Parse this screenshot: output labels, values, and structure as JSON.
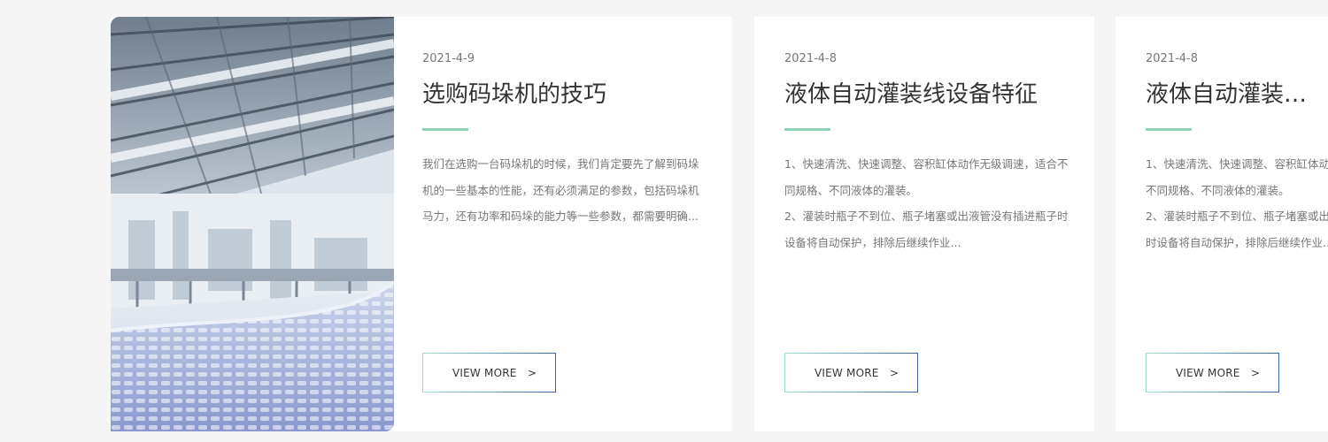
{
  "cards": [
    {
      "date": "2021-4-9",
      "title": "选购码垛机的技巧",
      "description": [
        "我们在选购一台码垛机的时候，我们肯定要先了解到码垛机的一些基本的性能，还有必须满足的参数，包括码垛机马力，还有功率和码垛的能力等一些参数，都需要明确..."
      ],
      "button_label": "VIEW MORE",
      "button_arrow": ">",
      "image_icon": "factory-conveyor-photo"
    },
    {
      "date": "2021-4-8",
      "title": "液体自动灌装线设备特征",
      "description": [
        "1、快速清洗、快速调整、容积缸体动作无级调速，适合不同规格、不同液体的灌装。",
        "2、灌装时瓶子不到位、瓶子堵塞或出液管没有插进瓶子时设备将自动保护，排除后继续作业..."
      ],
      "button_label": "VIEW MORE",
      "button_arrow": ">"
    },
    {
      "date": "2021-4-8",
      "title": "液体自动灌装线设备特征",
      "description": [
        "1、快速清洗、快速调整、容积缸体动",
        "不同规格、不同液体的灌装。",
        "2、灌装时瓶子不到位、瓶子堵塞或出",
        "时设备将自动保护，排除后继续作业..."
      ],
      "button_label": "VIEW MORE",
      "button_arrow": ">"
    }
  ],
  "colors": {
    "accent": "#8fd1b4",
    "button_gradient_start": "#9ee0cc",
    "button_gradient_end": "#3c64a8",
    "text_dark": "#333333",
    "text_muted": "#777777"
  }
}
